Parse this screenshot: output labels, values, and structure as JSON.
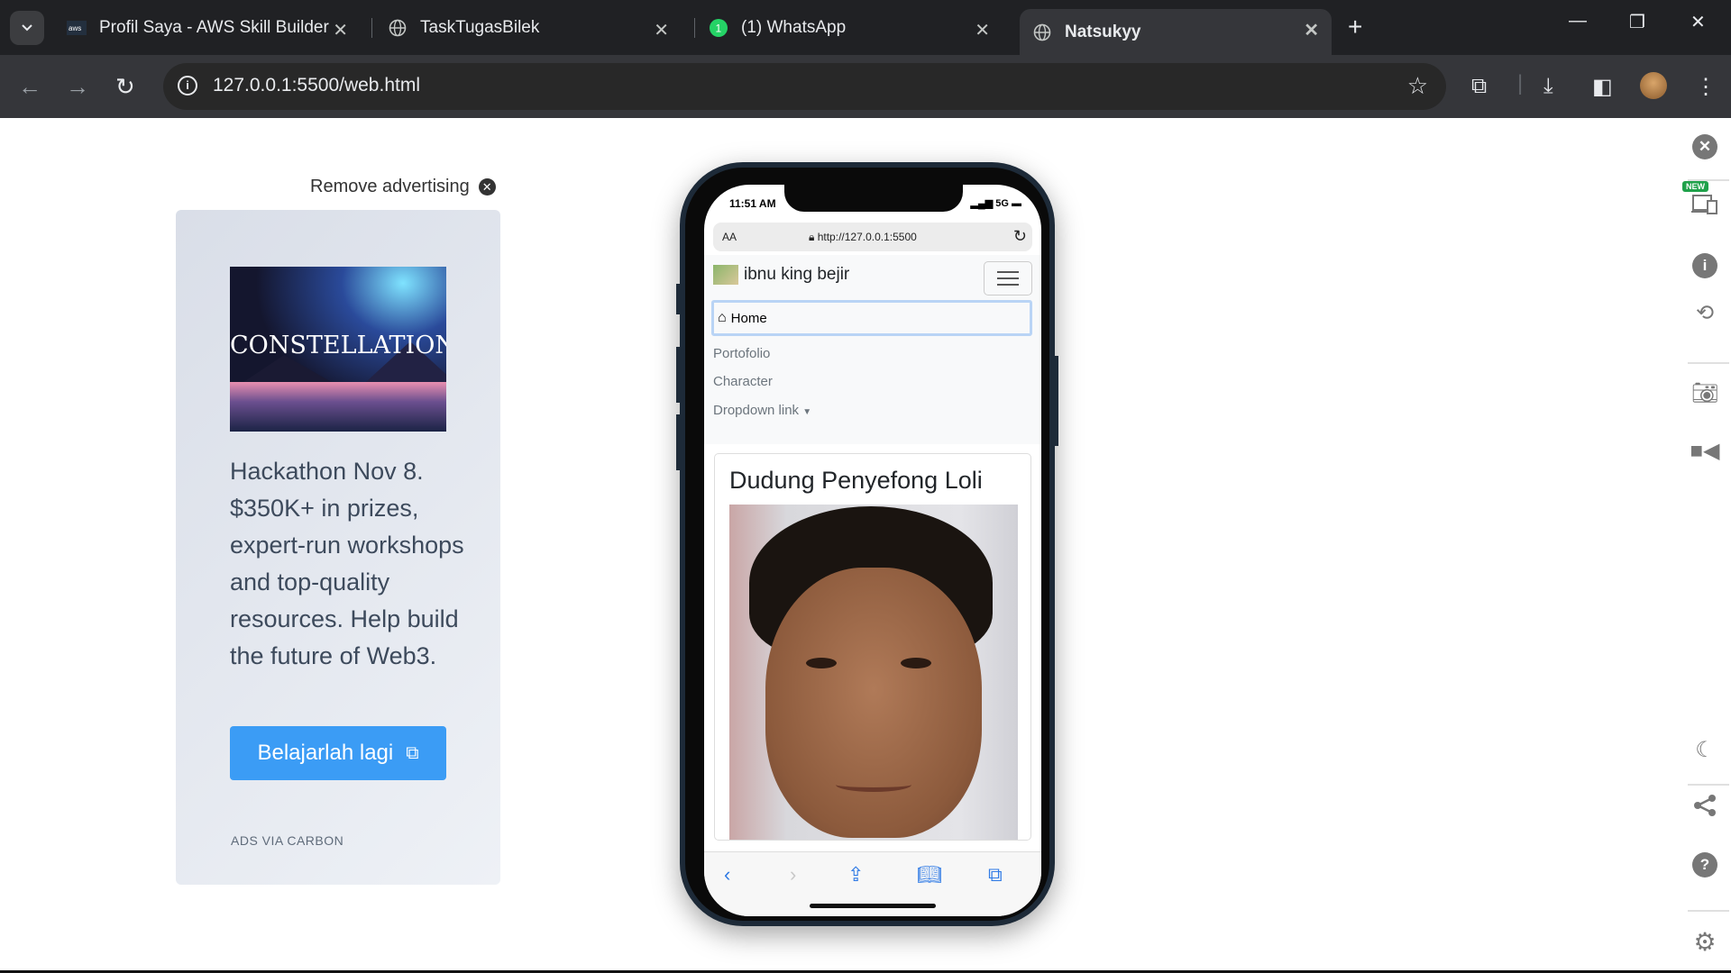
{
  "browser": {
    "tabs": [
      {
        "title": "Profil Saya - AWS Skill Builder",
        "icon": "aws-icon"
      },
      {
        "title": "TaskTugasBilek",
        "icon": "globe-icon"
      },
      {
        "title": "(1) WhatsApp",
        "icon": "whatsapp-icon"
      },
      {
        "title": "Natsukyy",
        "icon": "globe-icon",
        "active": true
      }
    ],
    "url": "127.0.0.1:5500/web.html"
  },
  "ad": {
    "remove_label": "Remove advertising",
    "image_title": "CONSTELLATION",
    "text": "Hackathon Nov 8. $350K+ in prizes, expert-run workshops and top-quality resources. Help build the future of Web3.",
    "button_label": "Belajarlah lagi",
    "via": "ADS VIA CARBON",
    "accent": "#3b9cf5"
  },
  "phone": {
    "time": "11:51 AM",
    "signal": "5G",
    "safari_aa": "AA",
    "safari_url": "http://127.0.0.1:5500",
    "brand": "ibnu king bejir",
    "nav": {
      "home": "Home",
      "portfolio": "Portofolio",
      "character": "Character",
      "dropdown": "Dropdown link"
    },
    "card_title": "Dudung Penyefong Loli"
  },
  "side_panel": {
    "new_badge": "NEW",
    "icons": [
      "close-icon",
      "responsive-icon",
      "info-icon",
      "rotate-icon",
      "camera-icon",
      "video-icon",
      "moon-icon",
      "share-icon",
      "help-icon",
      "gear-icon"
    ]
  }
}
